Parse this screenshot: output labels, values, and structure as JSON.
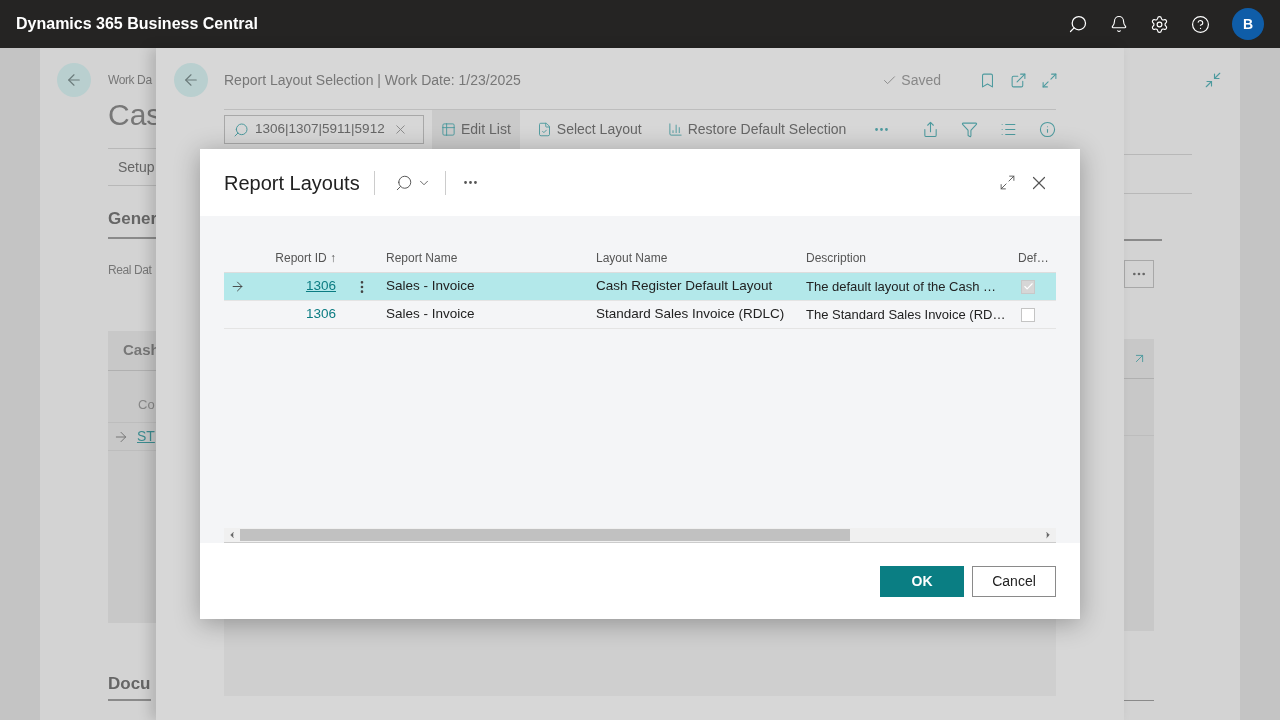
{
  "app_bar": {
    "title": "Dynamics 365 Business Central",
    "avatar": "B"
  },
  "background_page": {
    "breadcrumb": "Work Da",
    "title": "Cas",
    "tab": "Setup",
    "section": "Gener",
    "field_label": "Real Dat",
    "card_title": "Cash",
    "column_header": "Co",
    "row_link": "ST",
    "section_2": "Docu"
  },
  "page": {
    "title": "Report Layout Selection | Work Date: 1/23/2025",
    "status": "Saved",
    "search": {
      "value": "1306|1307|5911|5912"
    },
    "actions": [
      {
        "label": "Edit List",
        "selected": true
      },
      {
        "label": "Select Layout",
        "selected": false
      },
      {
        "label": "Restore Default Selection",
        "selected": false
      }
    ]
  },
  "dialog": {
    "title": "Report Layouts",
    "columns": [
      {
        "label": "Report ID",
        "sort_indicator": "↑"
      },
      {
        "label": "Report Name"
      },
      {
        "label": "Layout Name"
      },
      {
        "label": "Description"
      },
      {
        "label": "Def…"
      }
    ],
    "rows": [
      {
        "report_id": "1306",
        "report_name": "Sales - Invoice",
        "layout_name": "Cash Register Default Layout",
        "description": "The default layout of the Cash …",
        "default": true,
        "selected": true
      },
      {
        "report_id": "1306",
        "report_name": "Sales - Invoice",
        "layout_name": "Standard Sales Invoice (RDLC)",
        "description": "The Standard Sales Invoice (RD…",
        "default": false,
        "selected": false
      }
    ],
    "buttons": [
      {
        "label": "OK",
        "kind": "primary"
      },
      {
        "label": "Cancel",
        "kind": "secondary"
      }
    ]
  }
}
